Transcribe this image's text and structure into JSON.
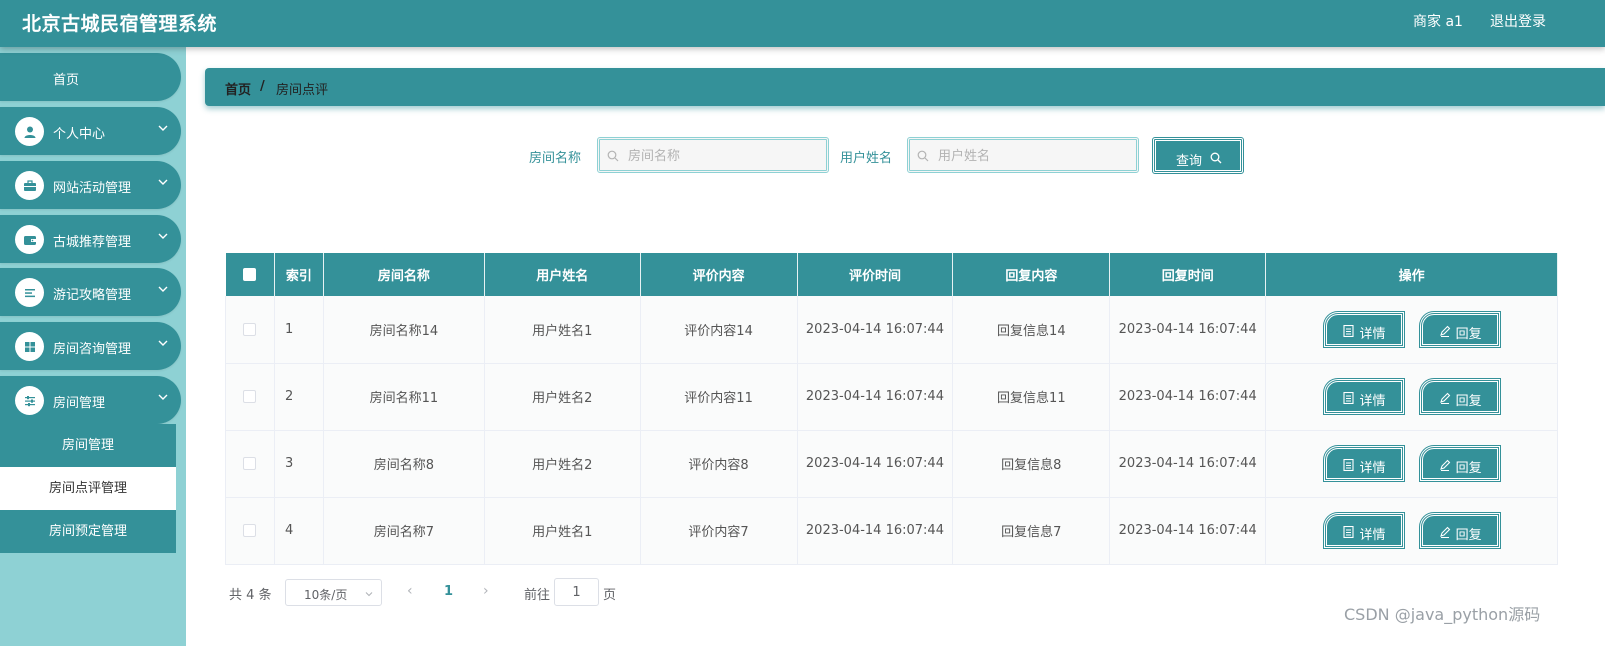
{
  "header": {
    "title": "北京古城民宿管理系统",
    "user": "商家 a1",
    "logout": "退出登录"
  },
  "sidebar": {
    "items": [
      {
        "label": "首页",
        "icon": "home"
      },
      {
        "label": "个人中心",
        "icon": "user-icon"
      },
      {
        "label": "网站活动管理",
        "icon": "briefcase-icon"
      },
      {
        "label": "古城推荐管理",
        "icon": "wallet-icon"
      },
      {
        "label": "游记攻略管理",
        "icon": "list-icon"
      },
      {
        "label": "房间咨询管理",
        "icon": "grid-icon"
      },
      {
        "label": "房间管理",
        "icon": "sliders-icon"
      }
    ],
    "submenu": [
      "房间管理",
      "房间点评管理",
      "房间预定管理"
    ],
    "active_submenu": "房间点评管理"
  },
  "breadcrumb": {
    "home": "首页",
    "separator": "/",
    "current": "房间点评"
  },
  "search": {
    "room_label": "房间名称",
    "room_placeholder": "房间名称",
    "user_label": "用户姓名",
    "user_placeholder": "用户姓名",
    "button": "查询"
  },
  "table": {
    "headers": [
      "索引",
      "房间名称",
      "用户姓名",
      "评价内容",
      "评价时间",
      "回复内容",
      "回复时间",
      "操作"
    ],
    "rows": [
      {
        "index": "1",
        "room": "房间名称14",
        "user": "用户姓名1",
        "review": "评价内容14",
        "review_time": "2023-04-14 16:07:44",
        "reply": "回复信息14",
        "reply_time": "2023-04-14 16:07:44"
      },
      {
        "index": "2",
        "room": "房间名称11",
        "user": "用户姓名2",
        "review": "评价内容11",
        "review_time": "2023-04-14 16:07:44",
        "reply": "回复信息11",
        "reply_time": "2023-04-14 16:07:44"
      },
      {
        "index": "3",
        "room": "房间名称8",
        "user": "用户姓名2",
        "review": "评价内容8",
        "review_time": "2023-04-14 16:07:44",
        "reply": "回复信息8",
        "reply_time": "2023-04-14 16:07:44"
      },
      {
        "index": "4",
        "room": "房间名称7",
        "user": "用户姓名1",
        "review": "评价内容7",
        "review_time": "2023-04-14 16:07:44",
        "reply": "回复信息7",
        "reply_time": "2023-04-14 16:07:44"
      }
    ],
    "detail_label": "详情",
    "reply_label": "回复"
  },
  "pagination": {
    "total": "共 4 条",
    "page_size": "10条/页",
    "prev": "‹",
    "current": "1",
    "next": "›",
    "goto": "前往",
    "goto_value": "1",
    "page_unit": "页"
  },
  "watermark": "CSDN @java_python源码",
  "colors": {
    "primary": "#349199",
    "sidebar_bg": "#8ed1d4"
  }
}
